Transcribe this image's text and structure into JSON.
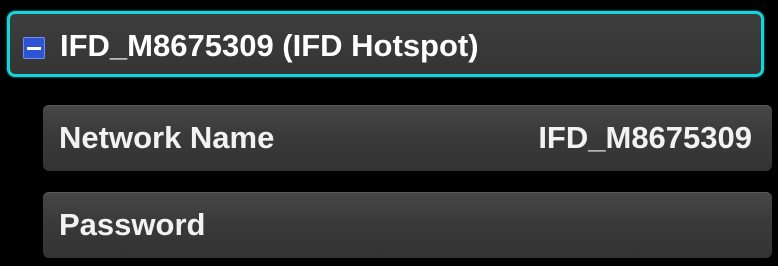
{
  "header": {
    "title": "IFD_M8675309 (IFD Hotspot)",
    "collapse_icon": "minus-icon",
    "accent_color": "#19d3dc",
    "collapse_color": "#2e54d6"
  },
  "settings": [
    {
      "label": "Network Name",
      "value": "IFD_M8675309"
    },
    {
      "label": "Password",
      "value": ""
    }
  ]
}
